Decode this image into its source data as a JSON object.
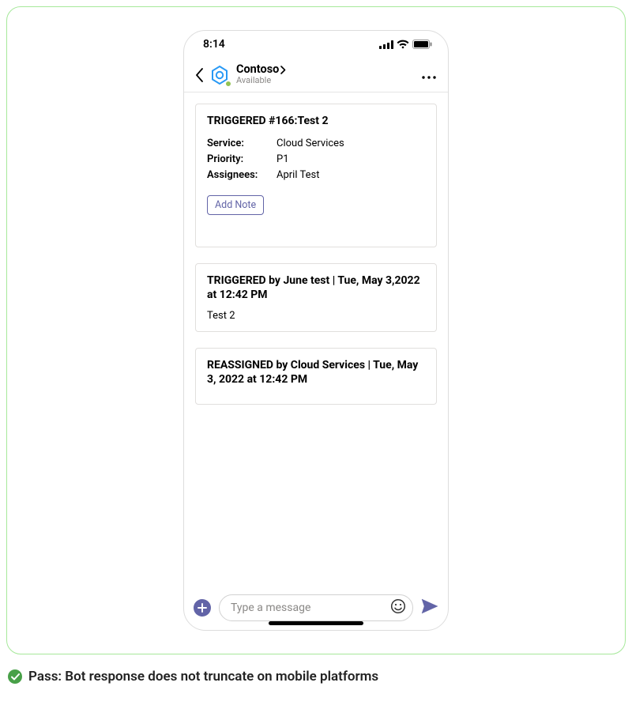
{
  "status": {
    "time": "8:14"
  },
  "header": {
    "title": "Contoso",
    "subtitle": "Available"
  },
  "cards": [
    {
      "title": "TRIGGERED #166:Test 2",
      "fields": [
        {
          "key": "Service:",
          "val": "Cloud Services"
        },
        {
          "key": "Priority:",
          "val": "P1"
        },
        {
          "key": "Assignees:",
          "val": "April Test"
        }
      ],
      "action": "Add Note"
    },
    {
      "title": "TRIGGERED by June test | Tue, May 3,2022 at 12:42 PM",
      "body": "Test 2"
    },
    {
      "title": "REASSIGNED by Cloud Services | Tue, May 3, 2022 at 12:42 PM"
    }
  ],
  "composer": {
    "placeholder": "Type a message"
  },
  "caption": "Pass: Bot response does not truncate on mobile platforms"
}
